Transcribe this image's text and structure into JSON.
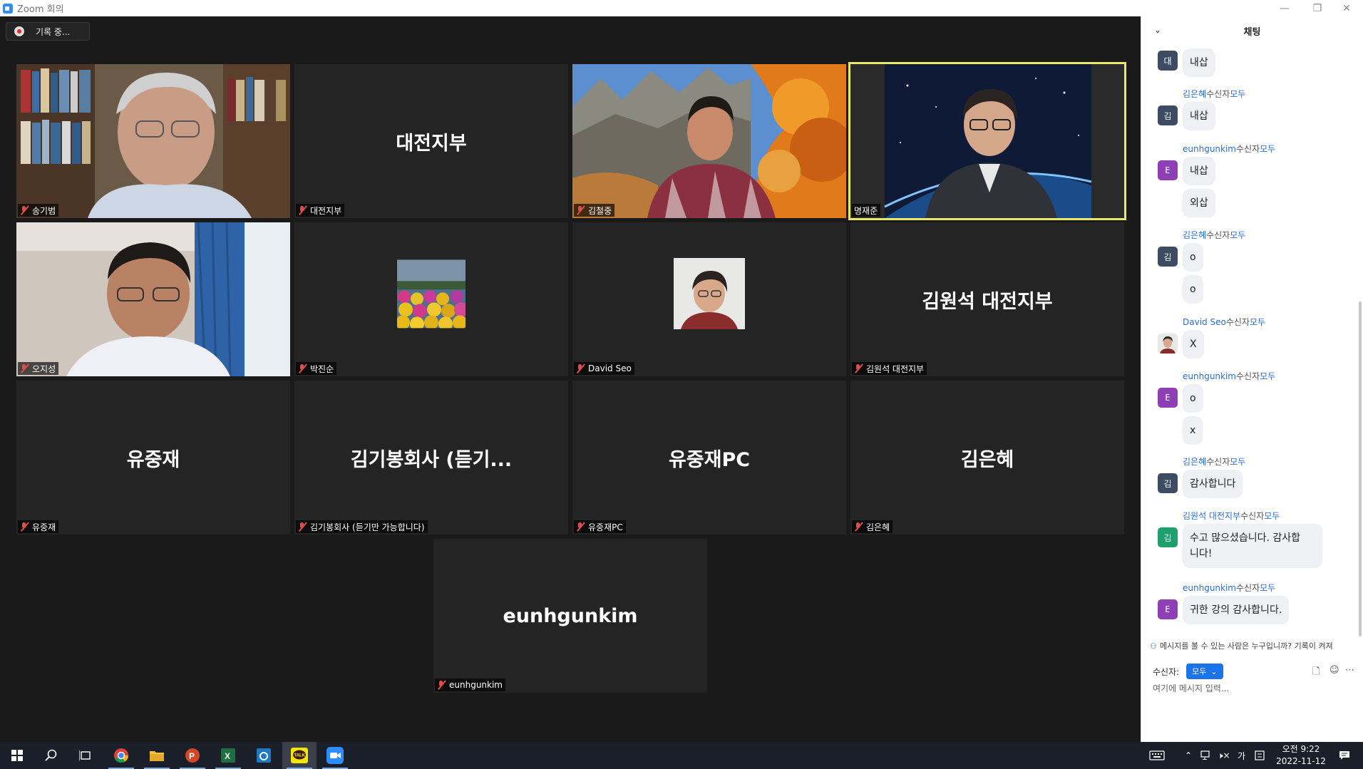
{
  "window": {
    "title": "Zoom 회의",
    "minimize": "—",
    "restore": "❐",
    "close": "✕"
  },
  "recording": {
    "label": "기록 중..."
  },
  "tiles": [
    {
      "name": "송기범",
      "type": "video",
      "active": false
    },
    {
      "name": "대전지부",
      "center": "대전지부",
      "type": "name"
    },
    {
      "name": "김철중",
      "type": "video",
      "active": false
    },
    {
      "name": "명재준",
      "type": "video",
      "active": true
    },
    {
      "name": "오지성",
      "type": "video",
      "active": false
    },
    {
      "name": "박진순",
      "type": "photo"
    },
    {
      "name": "David Seo",
      "type": "photo"
    },
    {
      "name": "김원석 대전지부",
      "center": "김원석 대전지부",
      "type": "name"
    },
    {
      "name": "유중재",
      "center": "유중재",
      "type": "name"
    },
    {
      "name": "김기봉회사 (듣기만 가능합니다)",
      "center": "김기봉회사 (듣기...",
      "type": "name"
    },
    {
      "name": "유중재PC",
      "center": "유중재PC",
      "type": "name"
    },
    {
      "name": "김은혜",
      "center": "김은혜",
      "type": "name"
    },
    {
      "name": "eunhgunkim",
      "center": "eunhgunkim",
      "type": "name"
    }
  ],
  "chat": {
    "title": "채팅",
    "to_word": "수신자",
    "everyone_word": "모두",
    "messages": [
      {
        "sender": "",
        "avatar": "대",
        "avatar_color": "#3d4b63",
        "bubbles": [
          "내삽"
        ]
      },
      {
        "sender": "김은혜",
        "avatar": "김",
        "avatar_color": "#3d4b63",
        "bubbles": [
          "내삽"
        ]
      },
      {
        "sender": "eunhgunkim",
        "avatar": "E",
        "avatar_color": "#8e3fb5",
        "bubbles": [
          "내삽",
          "외삽"
        ]
      },
      {
        "sender": "김은혜",
        "avatar": "김",
        "avatar_color": "#3d4b63",
        "bubbles": [
          "o",
          "o"
        ]
      },
      {
        "sender": "David Seo",
        "avatar": "photo",
        "avatar_color": "#999999",
        "bubbles": [
          "X"
        ]
      },
      {
        "sender": "eunhgunkim",
        "avatar": "E",
        "avatar_color": "#8e3fb5",
        "bubbles": [
          "o",
          "x"
        ]
      },
      {
        "sender": "김은혜",
        "avatar": "김",
        "avatar_color": "#3d4b63",
        "bubbles": [
          "감사합니다"
        ]
      },
      {
        "sender": "김원석 대전지부",
        "avatar": "김",
        "avatar_color": "#1f9e6e",
        "bubbles": [
          "수고 많으셨습니다. 감사합\n니다!"
        ]
      },
      {
        "sender": "eunhgunkim",
        "avatar": "E",
        "avatar_color": "#8e3fb5",
        "bubbles": [
          "귀한 강의 감사합니다."
        ]
      }
    ],
    "notice": "메시지를 볼 수 있는 사람은 누구입니까? 기록이 켜져",
    "recipient_label": "수신자:",
    "recipient_value": "모두",
    "input_placeholder": "여기에 메시지 입력..."
  },
  "taskbar": {
    "time": "오전 9:22",
    "date": "2022-11-12",
    "ime": "가",
    "kakao_label": "TALK"
  },
  "colors": {
    "accent_blue": "#2d8cff",
    "active_speaker": "#e8e86a",
    "mic_muted": "#e24c4c"
  }
}
